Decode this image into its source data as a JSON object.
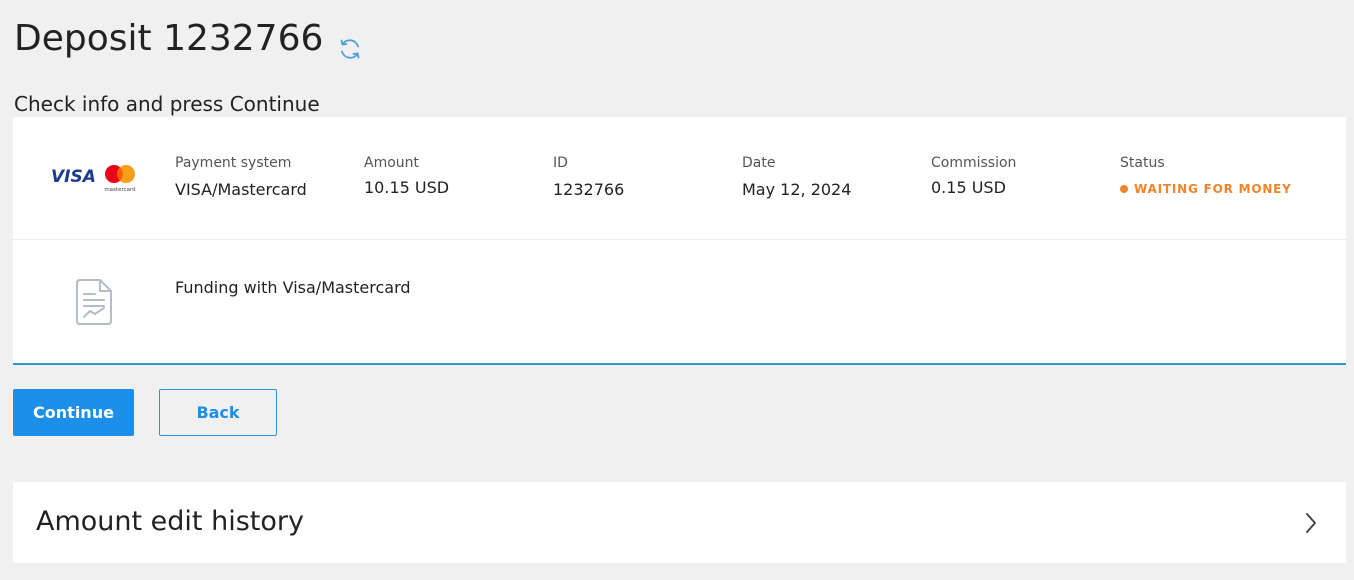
{
  "header": {
    "title": "Deposit 1232766",
    "subtitle": "Check info and press Continue"
  },
  "payment": {
    "brand_text": "VISA",
    "mastercard_text": "mastercard",
    "columns": [
      {
        "label": "Payment system",
        "value": "VISA/Mastercard"
      },
      {
        "label": "Amount",
        "value": "10.15 USD"
      },
      {
        "label": "ID",
        "value": "1232766"
      },
      {
        "label": "Date",
        "value": "May 12, 2024"
      },
      {
        "label": "Commission",
        "value": "0.15 USD"
      }
    ],
    "status": {
      "label": "Status",
      "value": "WAITING FOR MONEY",
      "color": "#f0842c"
    },
    "description": "Funding with Visa/Mastercard"
  },
  "actions": {
    "continue_label": "Continue",
    "back_label": "Back"
  },
  "history": {
    "title": "Amount edit history"
  },
  "colors": {
    "accent": "#1d8fe8",
    "background": "#f0f0f0",
    "status": "#f0842c",
    "visa_blue": "#1a3b8f"
  },
  "icons": [
    "refresh-icon",
    "mastercard-logo-icon",
    "document-chart-icon",
    "chevron-right-icon"
  ]
}
